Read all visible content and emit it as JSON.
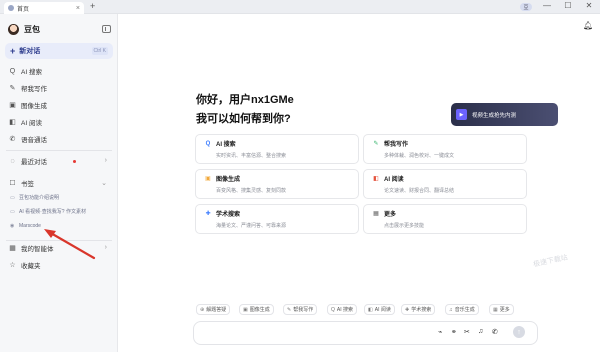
{
  "browser": {
    "tab_title": "首页",
    "new_tab": "+",
    "profile": "豆",
    "controls": {
      "minimize": "—",
      "maximize": "☐",
      "close": "✕"
    }
  },
  "sidebar": {
    "brand": "豆包",
    "new_chat": {
      "label": "新对话",
      "shortcut": "Ctrl K"
    },
    "nav": [
      {
        "icon": "ai-search-icon",
        "glyph": "Q",
        "label": "AI 搜索"
      },
      {
        "icon": "writing-icon",
        "glyph": "✎",
        "label": "帮我写作"
      },
      {
        "icon": "image-icon",
        "glyph": "▣",
        "label": "图像生成"
      },
      {
        "icon": "ai-read-icon",
        "glyph": "◧",
        "label": "AI 阅读"
      },
      {
        "icon": "phone-icon",
        "glyph": "✆",
        "label": "语音通话"
      }
    ],
    "recent": {
      "label": "最近对话",
      "icon": "chat-icon"
    },
    "bookmarks": {
      "label": "书签",
      "items": [
        "豆包功能介绍说明",
        "AI 看视频·查找我写? 作文素材",
        "Marscode"
      ]
    },
    "agents": {
      "label": "我的智能体"
    },
    "favorites": {
      "label": "收藏夹"
    }
  },
  "main": {
    "greeting": "你好，用户nx1GMe",
    "question": "我可以如何帮到你?",
    "promo": "视频生成抢先内测",
    "cards": [
      {
        "title": "AI 搜索",
        "desc": "实时资讯、丰富信源、整合搜索",
        "icon": "search-icon",
        "glyph": "Q",
        "color": "#3b7cff"
      },
      {
        "title": "帮我写作",
        "desc": "多种体裁、润色校对、一键成文",
        "icon": "pen-icon",
        "glyph": "✎",
        "color": "#34b36b"
      },
      {
        "title": "图像生成",
        "desc": "百变风格、搜集灵感、复刻同款",
        "icon": "image-icon",
        "glyph": "▣",
        "color": "#f2a93b"
      },
      {
        "title": "AI 阅读",
        "desc": "论文速读、财报合同、翻译总结",
        "icon": "reader-icon",
        "glyph": "◧",
        "color": "#e5533d"
      },
      {
        "title": "学术搜索",
        "desc": "海量论文、严谨问答、可靠来源",
        "icon": "academic-icon",
        "glyph": "✚",
        "color": "#3b7cff"
      },
      {
        "title": "更多",
        "desc": "点击展示更多技能",
        "icon": "more-icon",
        "glyph": "▦",
        "color": "#666666"
      }
    ],
    "watermark": "极速下载站",
    "chips": [
      {
        "label": "解题答疑",
        "glyph": "⊕"
      },
      {
        "label": "图像生成",
        "glyph": "▣"
      },
      {
        "label": "帮我写作",
        "glyph": "✎"
      },
      {
        "label": "AI 搜索",
        "glyph": "Q"
      },
      {
        "label": "AI 阅读",
        "glyph": "◧"
      },
      {
        "label": "学术搜索",
        "glyph": "✚"
      },
      {
        "label": "音乐生成",
        "glyph": "♫"
      },
      {
        "label": "更多",
        "glyph": "▦"
      }
    ],
    "tools": {
      "attach": "⌁",
      "link": "⚭",
      "scissors": "✂",
      "mic": "♫",
      "call": "✆",
      "send": "↑"
    }
  }
}
